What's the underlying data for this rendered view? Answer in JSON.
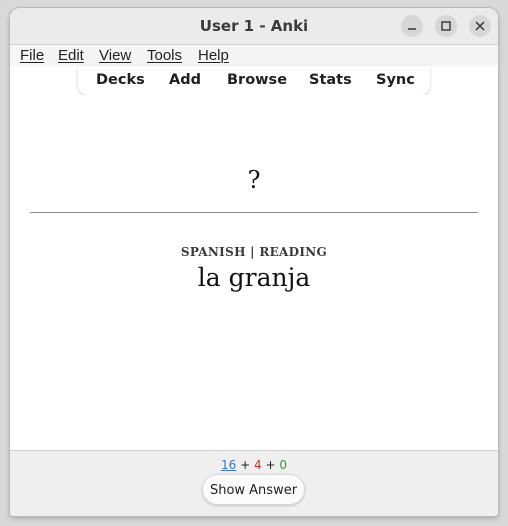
{
  "window": {
    "title": "User 1 - Anki"
  },
  "menubar": {
    "items": [
      {
        "label": "File"
      },
      {
        "label": "Edit"
      },
      {
        "label": "View"
      },
      {
        "label": "Tools"
      },
      {
        "label": "Help"
      }
    ]
  },
  "toolbar": {
    "links": [
      {
        "label": "Decks"
      },
      {
        "label": "Add"
      },
      {
        "label": "Browse"
      },
      {
        "label": "Stats"
      },
      {
        "label": "Sync"
      }
    ]
  },
  "card": {
    "question": "?",
    "meta": "SPANISH | READING",
    "answer": "la granja"
  },
  "counts": {
    "new": "16",
    "sep1": " + ",
    "learning": "4",
    "sep2": " + ",
    "review": "0",
    "colors": {
      "new": "#3478c6",
      "learning": "#c8322d",
      "review": "#2f9a3a"
    }
  },
  "bottombar": {
    "show_answer_label": "Show Answer"
  },
  "icons": {
    "minimize": "minimize-icon",
    "maximize": "maximize-icon",
    "close": "close-icon"
  }
}
